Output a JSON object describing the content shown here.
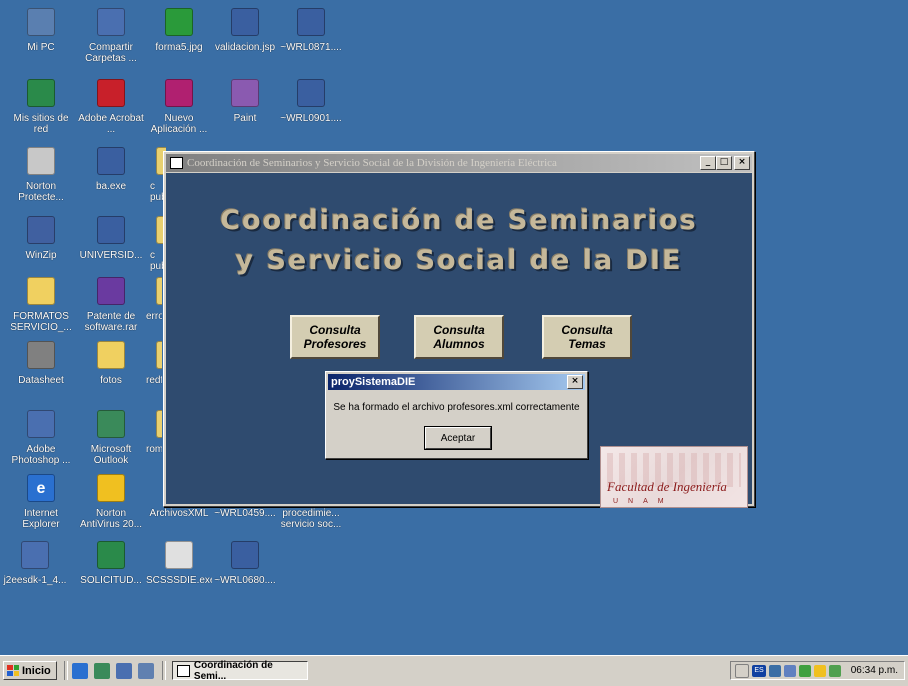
{
  "desktop": {
    "icons": [
      {
        "label": "Mi PC",
        "color": "#5a7fb0"
      },
      {
        "label": "Compartir Carpetas ...",
        "color": "#4a6fb0"
      },
      {
        "label": "forma5.jpg",
        "color": "#2a9a3a"
      },
      {
        "label": "validacion.jsp",
        "color": "#3a5fa0"
      },
      {
        "label": "~WRL0871....",
        "color": "#3a5fa0"
      },
      {
        "label": "Mis sitios de red",
        "color": "#2a8a4a"
      },
      {
        "label": "Adobe Acrobat ...",
        "color": "#c8202a"
      },
      {
        "label": "Nuevo Aplicación ...",
        "color": "#b02070"
      },
      {
        "label": "Paint",
        "color": "#8a5ab0"
      },
      {
        "label": "~WRL0901....",
        "color": "#3a5fa0"
      },
      {
        "label": "Norton Protecte...",
        "color": "#c8c8c8"
      },
      {
        "label": "ba.exe",
        "color": "#3a5fa0"
      },
      {
        "label": "c pub",
        "color": "#e8d070"
      },
      {
        "label": "WinZip",
        "color": "#4060a0"
      },
      {
        "label": "UNIVERSID...",
        "color": "#3a5fa0"
      },
      {
        "label": "c pub",
        "color": "#e8d070"
      },
      {
        "label": "FORMATOS SERVICIO_...",
        "color": "#f0d060"
      },
      {
        "label": "Patente de software.rar",
        "color": "#6a3aa0"
      },
      {
        "label": "erro",
        "color": "#e8d070"
      },
      {
        "label": "Datasheet",
        "color": "#808080"
      },
      {
        "label": "fotos",
        "color": "#f0d060"
      },
      {
        "label": "redf",
        "color": "#e8d070"
      },
      {
        "label": "Adobe Photoshop ...",
        "color": "#4a6fb0"
      },
      {
        "label": "Microsoft Outlook",
        "color": "#3a8a5a"
      },
      {
        "label": "rom",
        "color": "#e8d070"
      },
      {
        "label": "Internet Explorer",
        "color": "#2a70d0"
      },
      {
        "label": "Norton AntiVirus 20...",
        "color": "#f0c020"
      },
      {
        "label": "ArchivosXML",
        "color": "#e8d070"
      },
      {
        "label": "~WRL0459....",
        "color": "#3a5fa0"
      },
      {
        "label": "procedimie... servicio soc...",
        "color": "#3a5fa0"
      },
      {
        "label": "j2eesdk-1_4...",
        "color": "#4a6fb0"
      },
      {
        "label": "SOLICITUD...",
        "color": "#2a8a4a"
      },
      {
        "label": "SCSSSDIE.exe",
        "color": "#e0e0e0"
      },
      {
        "label": "~WRL0680....",
        "color": "#3a5fa0"
      }
    ]
  },
  "main_window": {
    "title": "Coordinación de Seminarios y Servicio Social de la División de Ingeniería Eléctrica",
    "heading_line1": "Coordinación de Seminarios",
    "heading_line2": "y Servicio Social de la DIE",
    "buttons": [
      {
        "label": "Consulta Profesores"
      },
      {
        "label": "Consulta Alumnos"
      },
      {
        "label": "Consulta Temas"
      }
    ],
    "logo_text": "Facultad de Ingeniería",
    "logo_sub": "UNAM",
    "controls": {
      "minimize": "_",
      "maximize": "□",
      "close": "×"
    }
  },
  "dialog": {
    "title": "proySistemaDIE",
    "message": "Se ha formado el archivo profesores.xml correctamente",
    "ok_label": "Aceptar",
    "close": "×"
  },
  "taskbar": {
    "start_label": "Inicio",
    "task_label": "Coordinación de Semi...",
    "clock": "06:34 p.m.",
    "tray_lang": "ES"
  }
}
